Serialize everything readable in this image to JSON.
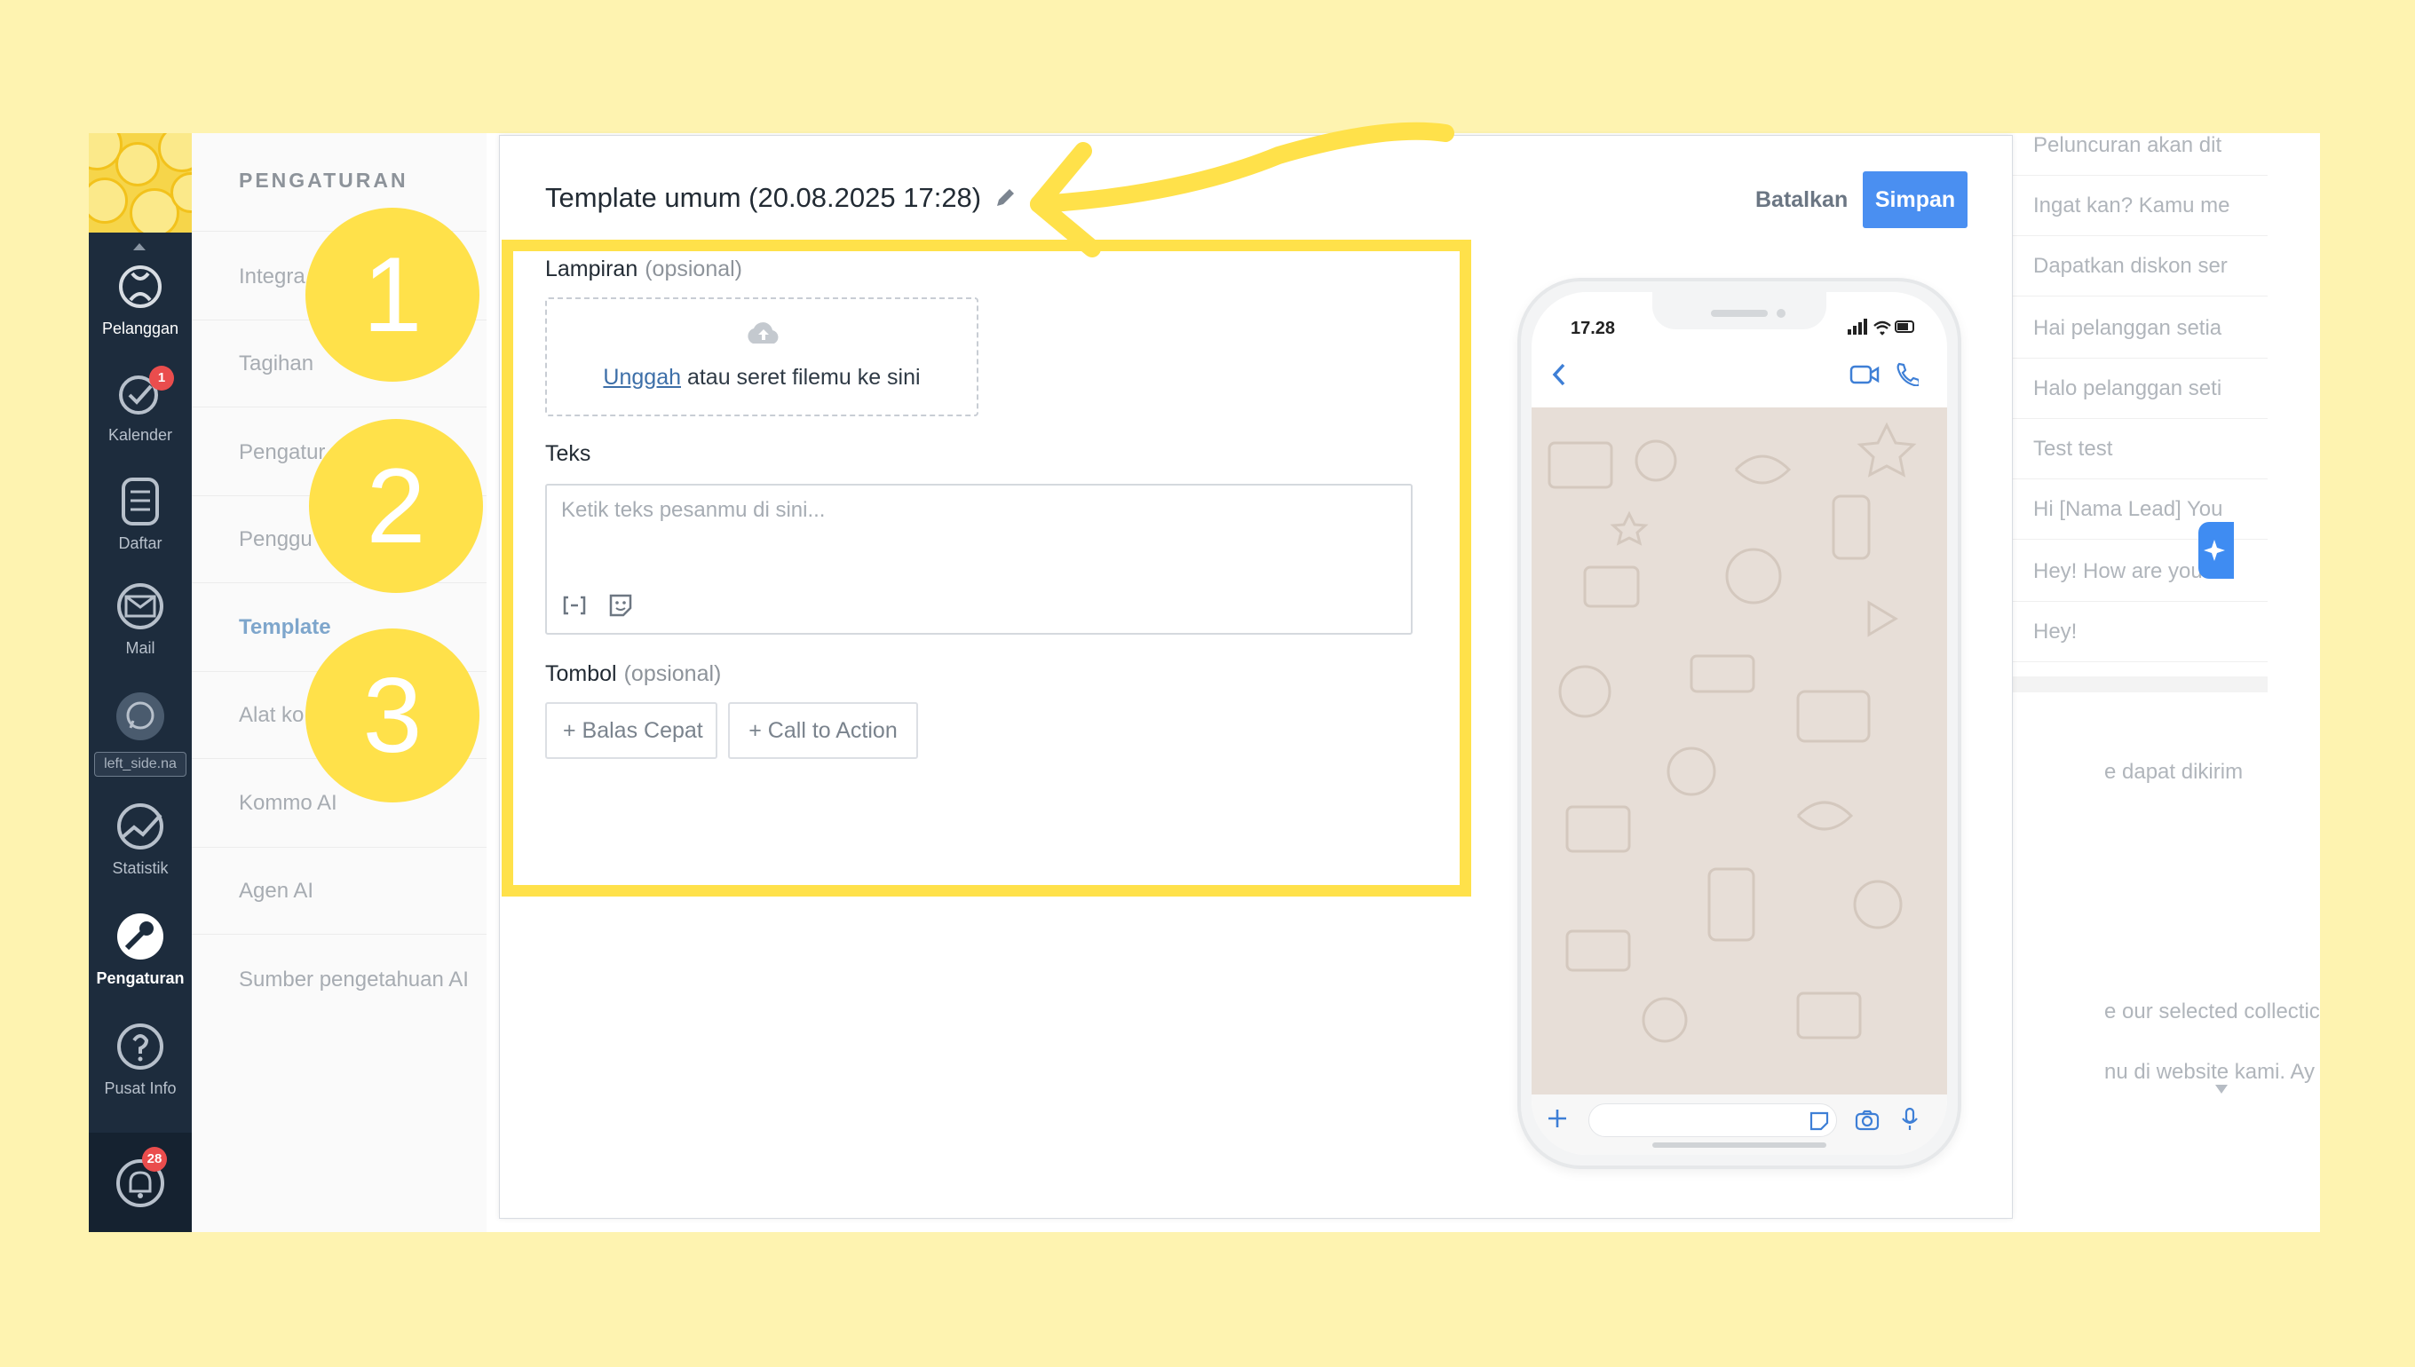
{
  "nav": {
    "items": [
      {
        "label": "Pelanggan",
        "icon": "customers-icon",
        "active": false
      },
      {
        "label": "Kalender",
        "icon": "check-calendar-icon",
        "badge": "1"
      },
      {
        "label": "Daftar",
        "icon": "list-icon"
      },
      {
        "label": "Mail",
        "icon": "mail-icon"
      },
      {
        "label": "left_side.na",
        "icon": "whatsapp-icon"
      },
      {
        "label": "Statistik",
        "icon": "stats-icon"
      },
      {
        "label": "Pengaturan",
        "icon": "wrench-icon",
        "active": true
      },
      {
        "label": "Pusat Info",
        "icon": "help-icon"
      }
    ],
    "notifications_badge": "28"
  },
  "settings": {
    "title": "PENGATURAN",
    "items": [
      "Integra",
      "Tagihan",
      "Pengatur",
      "Penggu",
      "Template",
      "Alat ko",
      "Kommo AI",
      "Agen AI",
      "Sumber pengetahuan AI"
    ],
    "active": "Template"
  },
  "bg_list": {
    "rows": [
      "Peluncuran akan dit",
      "Ingat kan? Kamu me",
      "Dapatkan diskon ser",
      "Hai pelanggan setia",
      "Halo pelanggan seti",
      "Test test",
      "Hi [Nama Lead] You",
      "Hey! How are you?",
      "Hey!"
    ],
    "cut_rows": [
      "e dapat dikirim",
      "e our selected collectic",
      "nu di website kami. Ay"
    ]
  },
  "modal": {
    "title": "Template umum (20.08.2025 17:28)",
    "cancel_label": "Batalkan",
    "save_label": "Simpan",
    "attachment": {
      "label": "Lampiran",
      "optional": "(opsional)",
      "link": "Unggah",
      "text": " atau seret filemu ke sini"
    },
    "text": {
      "label": "Teks",
      "placeholder": "Ketik teks pesanmu di sini..."
    },
    "buttons": {
      "label": "Tombol",
      "optional": "(opsional)",
      "quick_reply": "+ Balas Cepat",
      "cta": "+ Call to Action"
    }
  },
  "phone": {
    "time": "17.28"
  },
  "callouts": [
    "1",
    "2",
    "3"
  ],
  "colors": {
    "highlight": "#ffe14a",
    "primary": "#4a8ff1",
    "nav_bg": "#1d2c3d",
    "page_bg": "#fef3b0"
  }
}
